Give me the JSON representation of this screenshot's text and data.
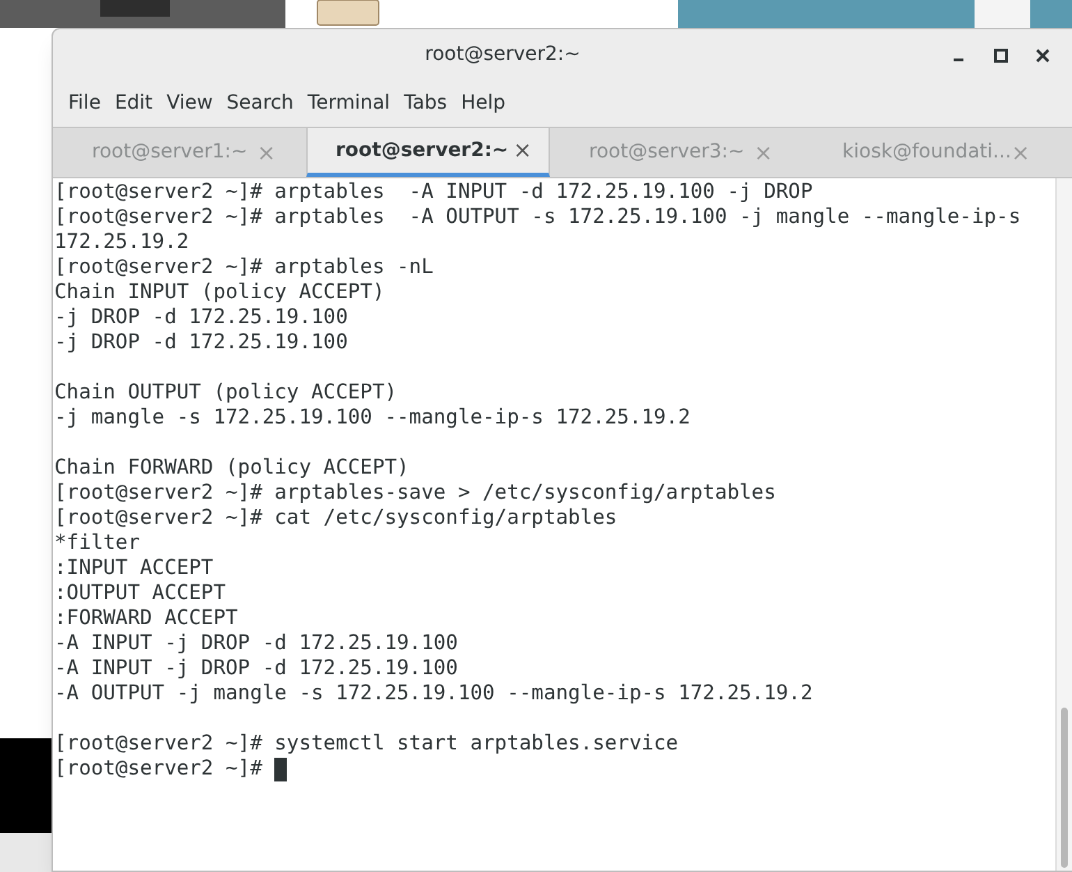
{
  "window": {
    "title": "root@server2:~"
  },
  "menu": [
    "File",
    "Edit",
    "View",
    "Search",
    "Terminal",
    "Tabs",
    "Help"
  ],
  "tabs": [
    {
      "label": "root@server1:~",
      "selected": false
    },
    {
      "label": "root@server2:~",
      "selected": true
    },
    {
      "label": "root@server3:~",
      "selected": false
    },
    {
      "label": "kiosk@foundati...",
      "selected": false
    }
  ],
  "tab_close": "×",
  "terminal": {
    "blocks": [
      [
        "[root@server2 ~]# arptables  -A INPUT -d 172.25.19.100 -j DROP",
        "[root@server2 ~]# arptables  -A OUTPUT -s 172.25.19.100 -j mangle --mangle-ip-s",
        "172.25.19.2",
        "[root@server2 ~]# arptables -nL",
        "Chain INPUT (policy ACCEPT)",
        "-j DROP -d 172.25.19.100",
        "-j DROP -d 172.25.19.100"
      ],
      [
        "Chain OUTPUT (policy ACCEPT)",
        "-j mangle -s 172.25.19.100 --mangle-ip-s 172.25.19.2"
      ],
      [
        "Chain FORWARD (policy ACCEPT)",
        "[root@server2 ~]# arptables-save > /etc/sysconfig/arptables",
        "[root@server2 ~]# cat /etc/sysconfig/arptables",
        "*filter",
        ":INPUT ACCEPT",
        ":OUTPUT ACCEPT",
        ":FORWARD ACCEPT",
        "-A INPUT -j DROP -d 172.25.19.100",
        "-A INPUT -j DROP -d 172.25.19.100",
        "-A OUTPUT -j mangle -s 172.25.19.100 --mangle-ip-s 172.25.19.2"
      ],
      [
        "[root@server2 ~]# systemctl start arptables.service",
        "[root@server2 ~]# "
      ]
    ],
    "cursor": true
  }
}
